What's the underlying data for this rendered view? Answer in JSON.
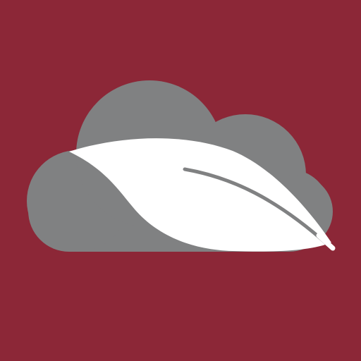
{
  "icon": {
    "name": "cloud-leaf-logo",
    "background_color": "#8c2737",
    "cloud_color": "#808182",
    "leaf_color": "#ffffff",
    "elements": [
      "cloud-icon",
      "leaf-icon"
    ]
  }
}
